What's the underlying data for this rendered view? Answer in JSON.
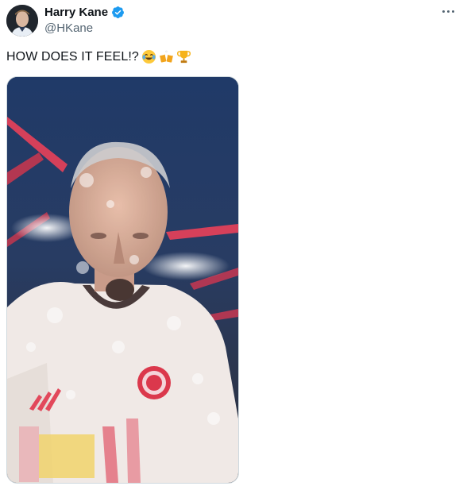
{
  "tweet": {
    "author": {
      "display_name": "Harry Kane",
      "handle": "@HKane",
      "verified": true,
      "avatar_icon": "profile-photo-avatar"
    },
    "text": "HOW DOES IT FEEL!?",
    "emojis": [
      "face-with-tears-of-joy-icon",
      "clinking-beer-mugs-icon",
      "trophy-icon"
    ],
    "more_icon": "more-horizontal-icon",
    "media": {
      "type": "video",
      "description_icon": "video-thumbnail"
    },
    "colors": {
      "verified_blue": "#1d9bf0",
      "text_primary": "#0f1419",
      "text_secondary": "#536471",
      "border": "#cfd9de"
    }
  }
}
